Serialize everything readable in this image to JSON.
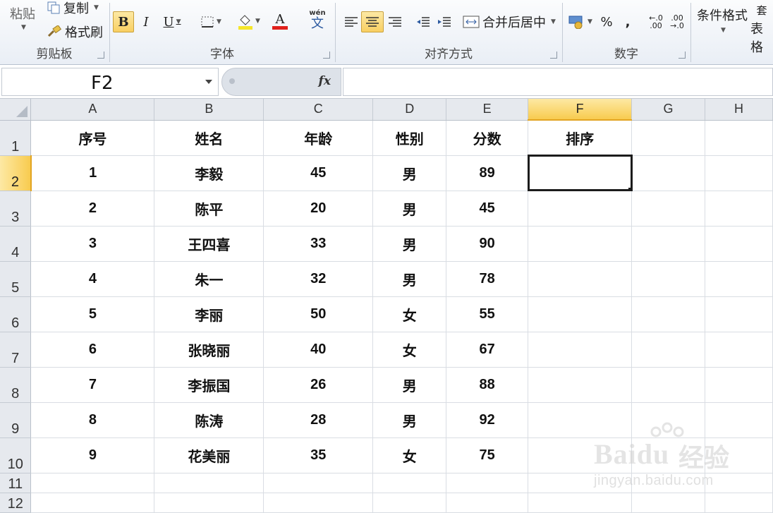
{
  "ribbon": {
    "clipboard": {
      "paste": "粘贴",
      "copy": "复制",
      "format_painter": "格式刷",
      "label": "剪贴板"
    },
    "font": {
      "bold": "B",
      "italic": "I",
      "underline": "U",
      "font_color_glyph": "A",
      "phonetic_glyph": "wén",
      "label": "字体"
    },
    "alignment": {
      "merge_center": "合并后居中",
      "label": "对齐方式"
    },
    "number": {
      "percent": "%",
      "comma": ",",
      "label": "数字"
    },
    "styles": {
      "conditional_format": "条件格式",
      "table_format_partial": "表格",
      "partial_top": "套"
    }
  },
  "formula_bar": {
    "name_box": "F2",
    "fx": "fx",
    "formula": ""
  },
  "columns": [
    "A",
    "B",
    "C",
    "D",
    "E",
    "F",
    "G",
    "H"
  ],
  "selected_column": "F",
  "rows": [
    "1",
    "2",
    "3",
    "4",
    "5",
    "6",
    "7",
    "8",
    "9",
    "10",
    "11",
    "12"
  ],
  "selected_row": "2",
  "headers": [
    "序号",
    "姓名",
    "年龄",
    "性别",
    "分数",
    "排序"
  ],
  "table": [
    [
      "1",
      "李毅",
      "45",
      "男",
      "89",
      ""
    ],
    [
      "2",
      "陈平",
      "20",
      "男",
      "45",
      ""
    ],
    [
      "3",
      "王四喜",
      "33",
      "男",
      "90",
      ""
    ],
    [
      "4",
      "朱一",
      "32",
      "男",
      "78",
      ""
    ],
    [
      "5",
      "李丽",
      "50",
      "女",
      "55",
      ""
    ],
    [
      "6",
      "张晓丽",
      "40",
      "女",
      "67",
      ""
    ],
    [
      "7",
      "李振国",
      "26",
      "男",
      "88",
      ""
    ],
    [
      "8",
      "陈涛",
      "28",
      "男",
      "92",
      ""
    ],
    [
      "9",
      "花美丽",
      "35",
      "女",
      "75",
      ""
    ]
  ],
  "watermark": {
    "brand": "Baidu",
    "zh": "经验",
    "url": "jingyan.baidu.com"
  },
  "colors": {
    "selection_header": "#f8cb4f",
    "accent_font_color": "#e0201b",
    "highlight_color": "#f5e62a"
  }
}
